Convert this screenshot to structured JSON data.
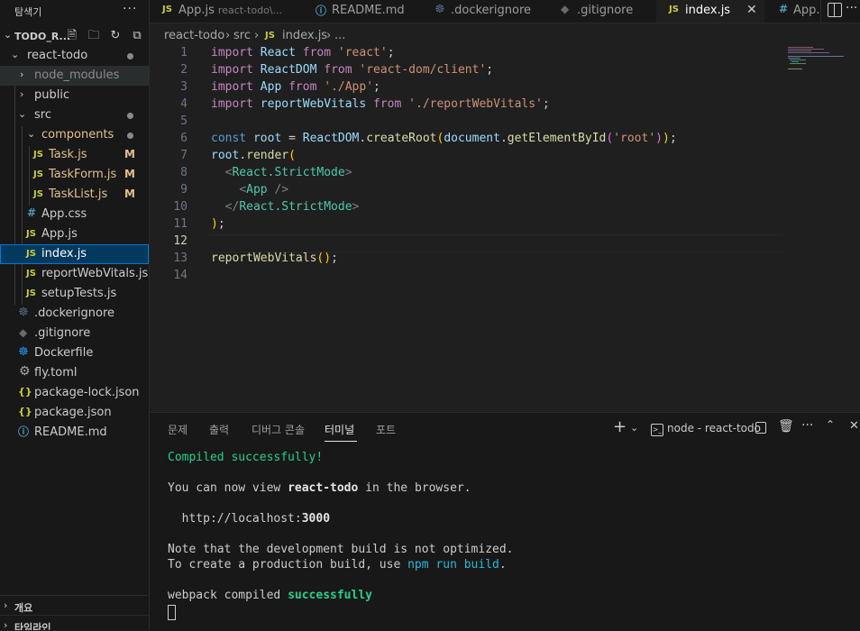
{
  "sidebar": {
    "title": "탐색기",
    "more": "···",
    "section_title": "TODO_R...",
    "tree": [
      {
        "label": "react-todo",
        "icon": "",
        "status": "dot",
        "color": "#cccccc"
      },
      {
        "label": "node_modules",
        "icon": "",
        "status": "",
        "color": "#8c8c8c"
      },
      {
        "label": "public",
        "icon": "",
        "status": "",
        "color": "#cccccc"
      },
      {
        "label": "src",
        "icon": "",
        "status": "dot",
        "color": "#cccccc"
      },
      {
        "label": "components",
        "icon": "",
        "status": "dot",
        "color": "#e2c08d"
      },
      {
        "label": "Task.js",
        "icon": "JS",
        "status": "M",
        "color": "#e2c08d"
      },
      {
        "label": "TaskForm.js",
        "icon": "JS",
        "status": "M",
        "color": "#e2c08d"
      },
      {
        "label": "TaskList.js",
        "icon": "JS",
        "status": "M",
        "color": "#e2c08d"
      },
      {
        "label": "App.css",
        "icon": "#",
        "status": "",
        "color": "#cccccc"
      },
      {
        "label": "App.js",
        "icon": "JS",
        "status": "",
        "color": "#cccccc"
      },
      {
        "label": "index.js",
        "icon": "JS",
        "status": "",
        "color": "#ffffff"
      },
      {
        "label": "reportWebVitals.js",
        "icon": "JS",
        "status": "",
        "color": "#cccccc"
      },
      {
        "label": "setupTests.js",
        "icon": "JS",
        "status": "",
        "color": "#cccccc"
      },
      {
        "label": ".dockerignore",
        "icon": "docker",
        "status": "",
        "color": "#cccccc"
      },
      {
        "label": ".gitignore",
        "icon": "git",
        "status": "",
        "color": "#cccccc"
      },
      {
        "label": "Dockerfile",
        "icon": "docker",
        "status": "",
        "color": "#cccccc"
      },
      {
        "label": "fly.toml",
        "icon": "gear",
        "status": "",
        "color": "#cccccc"
      },
      {
        "label": "package-lock.json",
        "icon": "{}",
        "status": "",
        "color": "#cccccc"
      },
      {
        "label": "package.json",
        "icon": "{}",
        "status": "",
        "color": "#cccccc"
      },
      {
        "label": "README.md",
        "icon": "info",
        "status": "",
        "color": "#cccccc"
      }
    ],
    "outline": "개요",
    "timeline": "타임라인"
  },
  "tabs": [
    {
      "label": "App.js",
      "desc": "react-todo\\...",
      "icon": "JS"
    },
    {
      "label": "README.md",
      "desc": "",
      "icon": "info"
    },
    {
      "label": ".dockerignore",
      "desc": "",
      "icon": "docker"
    },
    {
      "label": ".gitignore",
      "desc": "",
      "icon": "git"
    },
    {
      "label": "index.js",
      "desc": "",
      "icon": "JS"
    },
    {
      "label": "App.",
      "desc": "",
      "icon": "#"
    }
  ],
  "breadcrumb": [
    "react-todo",
    "src",
    "index.js",
    "..."
  ],
  "editor": {
    "line_numbers": [
      "1",
      "2",
      "3",
      "4",
      "5",
      "6",
      "7",
      "8",
      "9",
      "10",
      "11",
      "12",
      "13",
      "14"
    ],
    "current_line": "12"
  },
  "panel": {
    "tabs": [
      "문제",
      "출력",
      "디버그 콘솔",
      "터미널",
      "포트"
    ],
    "active_tab": "터미널",
    "terminal_name": "node - react-todo",
    "lines": {
      "compiled": "Compiled successfully!",
      "view_prefix": "You can now view ",
      "view_app": "react-todo",
      "view_suffix": " in the browser.",
      "url_prefix": "  http://localhost:",
      "url_port": "3000",
      "note1": "Note that the development build is not optimized.",
      "note2_prefix": "To create a production build, use ",
      "note2_cmd": "npm run build",
      "note2_suffix": ".",
      "webpack_prefix": "webpack compiled ",
      "webpack_status": "successfully"
    }
  },
  "colors": {
    "accent": "#0078d4",
    "modified": "#e2c08d",
    "js_icon": "#cbcb41",
    "success": "#23d18b"
  }
}
